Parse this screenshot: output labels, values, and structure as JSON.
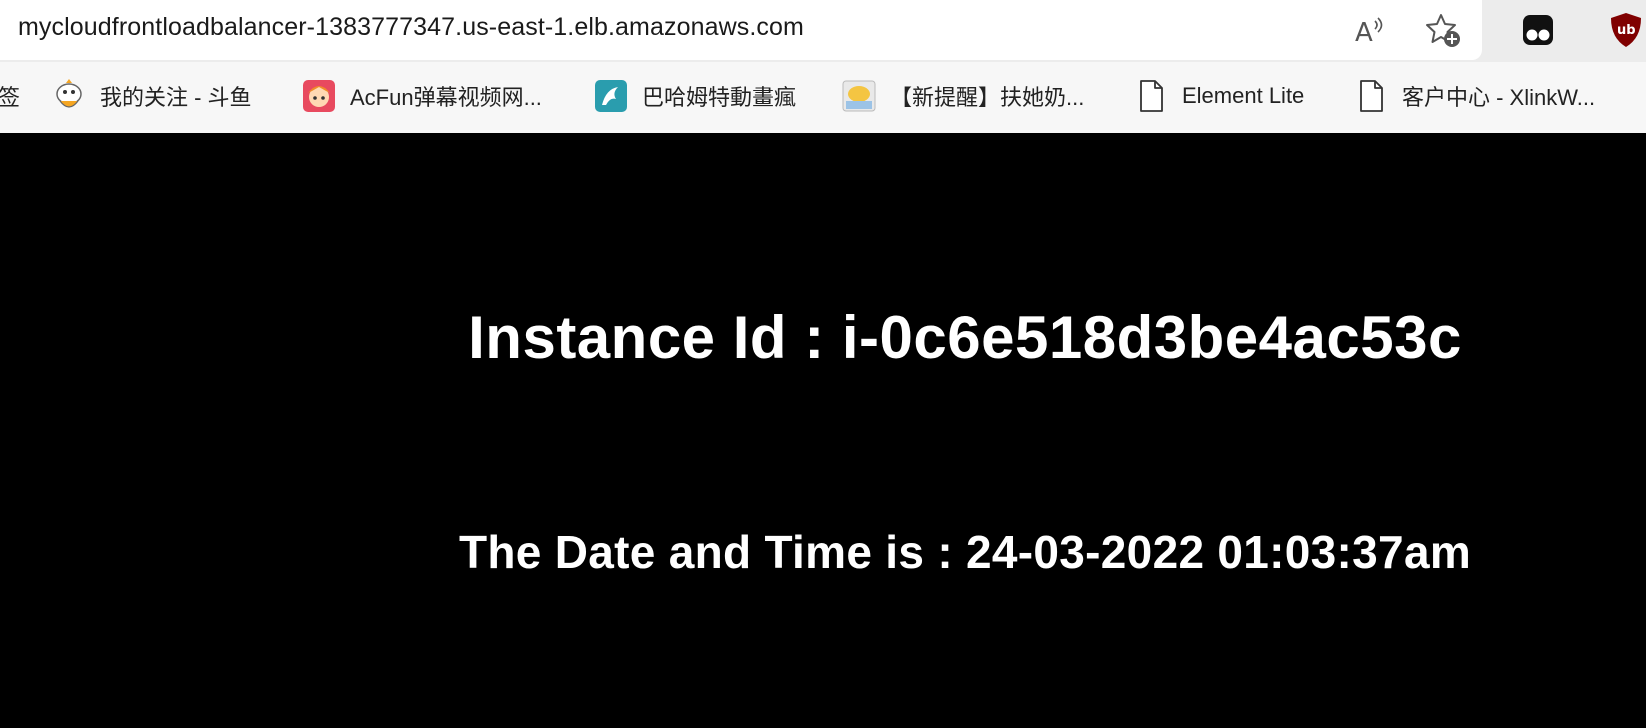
{
  "browser": {
    "url": "mycloudfrontloadbalancer-1383777347.us-east-1.elb.amazonaws.com",
    "address_icons": [
      "read-aloud-icon",
      "add-favorite-icon"
    ],
    "extensions": [
      "tampermonkey-icon",
      "ublock-origin-icon"
    ]
  },
  "bookmarks": [
    {
      "label": "签",
      "icon": "bookmark-folder-partial"
    },
    {
      "label": "我的关注 - 斗鱼",
      "icon": "douyu-icon"
    },
    {
      "label": "AcFun弹幕视频网...",
      "icon": "acfun-icon"
    },
    {
      "label": "巴哈姆特動畫瘋",
      "icon": "bahamut-icon"
    },
    {
      "label": "【新提醒】扶她奶...",
      "icon": "image-favicon"
    },
    {
      "label": "Element Lite",
      "icon": "document-icon"
    },
    {
      "label": "客户中心 - XlinkW...",
      "icon": "document-icon"
    }
  ],
  "page": {
    "instance_label": "Instance Id : i-0c6e518d3be4ac53c",
    "datetime_label": "The Date and Time is : 24-03-2022 01:03:37am"
  },
  "colors": {
    "page_background": "#000000",
    "page_text": "#ffffff",
    "chrome_background": "#f7f7f7"
  }
}
